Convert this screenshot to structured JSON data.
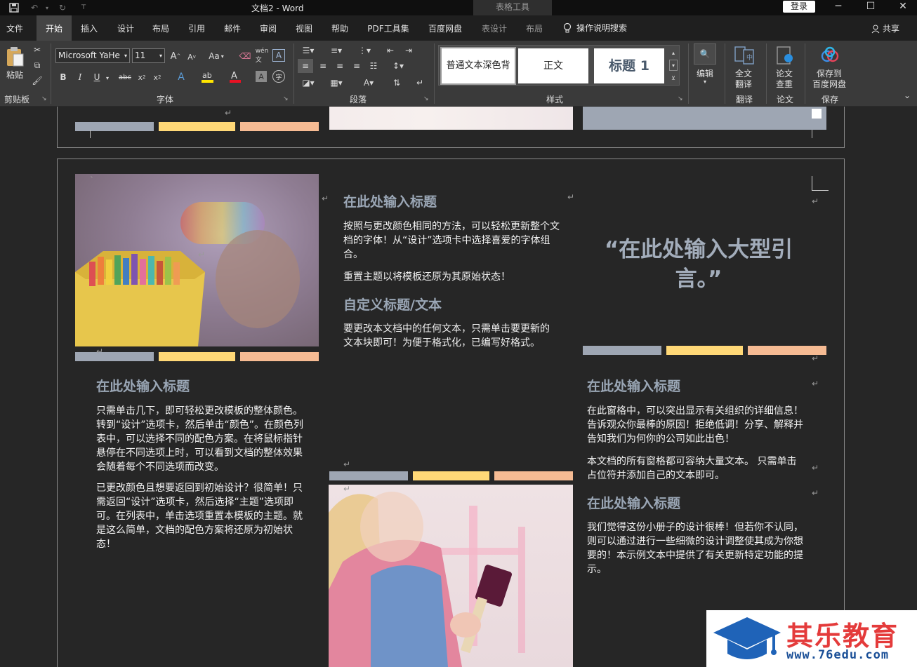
{
  "window": {
    "doc_title": "文档2  -  Word",
    "context_tab": "表格工具",
    "login_label": "登录"
  },
  "tabs": [
    {
      "label": "文件"
    },
    {
      "label": "开始"
    },
    {
      "label": "插入"
    },
    {
      "label": "设计"
    },
    {
      "label": "布局"
    },
    {
      "label": "引用"
    },
    {
      "label": "邮件"
    },
    {
      "label": "审阅"
    },
    {
      "label": "视图"
    },
    {
      "label": "帮助"
    },
    {
      "label": "PDF工具集"
    },
    {
      "label": "百度网盘"
    },
    {
      "label": "表设计"
    },
    {
      "label": "布局"
    }
  ],
  "tell_me": "操作说明搜索",
  "share": "共享",
  "ribbon": {
    "clipboard": {
      "paste": "粘贴",
      "label": "剪贴板"
    },
    "font": {
      "name": "Microsoft YaHe",
      "size": "11",
      "label": "字体",
      "case": "Aa"
    },
    "paragraph": {
      "label": "段落"
    },
    "styles": {
      "label": "样式",
      "items": [
        "普通文本深色背",
        "正文",
        "标题 1"
      ]
    },
    "editing": {
      "label": "编辑"
    },
    "translate": {
      "button": "全文\n翻译",
      "btn_line1": "全文",
      "btn_line2": "翻译",
      "label": "翻译"
    },
    "paper": {
      "btn_line1": "论文",
      "btn_line2": "查重",
      "label": "论文"
    },
    "save": {
      "btn_line1": "保存到",
      "btn_line2": "百度网盘",
      "label": "保存"
    }
  },
  "document": {
    "col2": {
      "heading1": "在此处输入标题",
      "para1": "按照与更改颜色相同的方法，可以轻松更新整个文档的字体！从“设计”选项卡中选择喜爱的字体组合。",
      "para2": "重置主题以将模板还原为其原始状态！",
      "heading2": "自定义标题/文本",
      "para3": "要更改本文档中的任何文本，只需单击要更新的文本块即可！为便于格式化，已编写好格式。"
    },
    "col1": {
      "heading": "在此处输入标题",
      "para1": "只需单击几下，即可轻松更改模板的整体颜色。转到“设计”选项卡，然后单击“颜色”。在颜色列表中，可以选择不同的配色方案。在将鼠标指针悬停在不同选项上时，可以看到文档的整体效果会随着每个不同选项而改变。",
      "para2": "已更改颜色且想要返回到初始设计？很简单！只需返回“设计”选项卡，然后选择“主题”选项即可。在列表中，单击选项重置本模板的主题。就是这么简单，文档的配色方案将还原为初始状态！"
    },
    "col3": {
      "quote": "“在此处输入大型引言。”",
      "heading1": "在此处输入标题",
      "para1": "在此窗格中，可以突出显示有关组织的详细信息！告诉观众你最棒的原因！拒绝低调！分享、解释并告知我们为何你的公司如此出色！",
      "para2": "本文档的所有窗格都可容纳大量文本。 只需单击占位符并添加自己的文本即可。",
      "heading2": "在此处输入标题",
      "para3": "我们觉得这份小册子的设计很棒！但若你不认同，则可以通过进行一些细微的设计调整使其成为你想要的！本示例文本中提供了有关更新特定功能的提示。"
    }
  },
  "watermark": {
    "title": "其乐教育",
    "url": "www.76edu.com"
  },
  "colors": {
    "bar_gray": "#9ea6b3",
    "bar_yellow": "#ffd877",
    "bar_peach": "#f6bb93",
    "heading": "#9aa6b5",
    "watermark_red": "#e43b3b",
    "watermark_blue": "#1a4f97"
  }
}
